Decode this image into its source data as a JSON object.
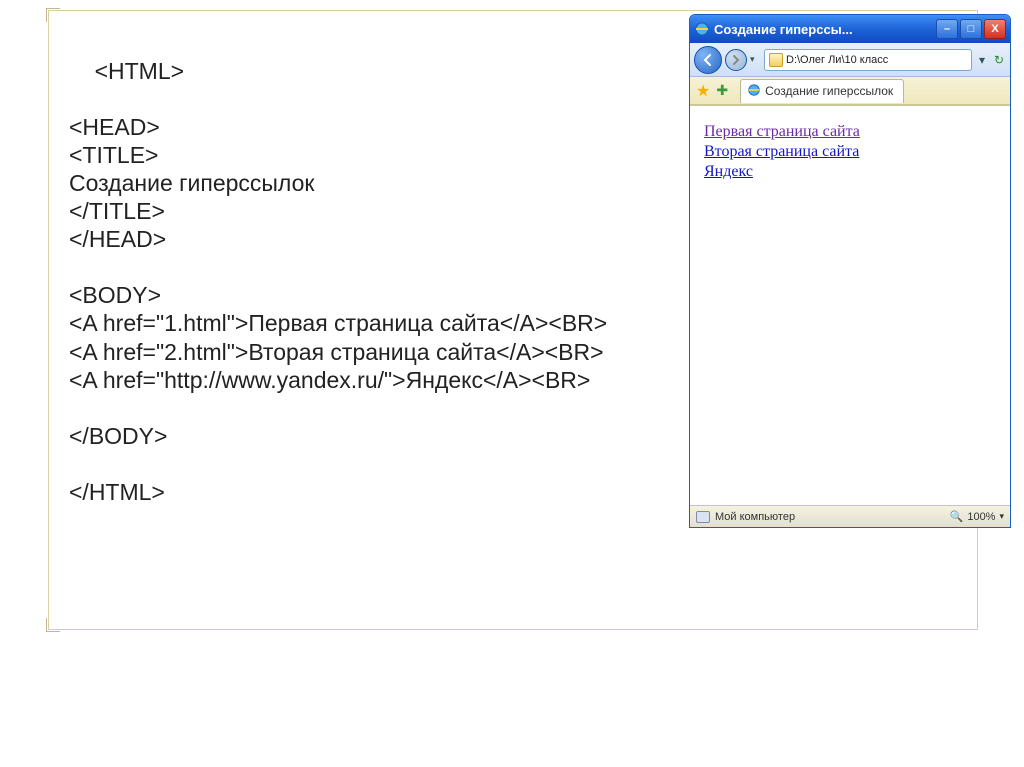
{
  "code": {
    "lines": [
      "<HTML>",
      "",
      "<HEAD>",
      "<TITLE>",
      "Создание гиперссылок",
      "</TITLE>",
      "</HEAD>",
      "",
      "<BODY>",
      "<A href=\"1.html\">Первая страница сайта</A><BR>",
      "<A href=\"2.html\">Вторая страница сайта</A><BR>",
      "<A href=\"http://www.yandex.ru/\">Яндекс</A><BR>",
      "",
      "</BODY>",
      "",
      "</HTML>"
    ]
  },
  "browser": {
    "title": "Создание гиперссы...",
    "address": "D:\\Олег Ли\\10 класс",
    "tab_label": "Создание гиперссылок",
    "links": {
      "first": "Первая страница сайта",
      "second": "Вторая страница сайта",
      "third": "Яндекс"
    },
    "statusbar": {
      "computer": "Мой компьютер",
      "zoom": "100%"
    },
    "buttons": {
      "minimize": "–",
      "maximize": "□",
      "close": "X"
    }
  }
}
